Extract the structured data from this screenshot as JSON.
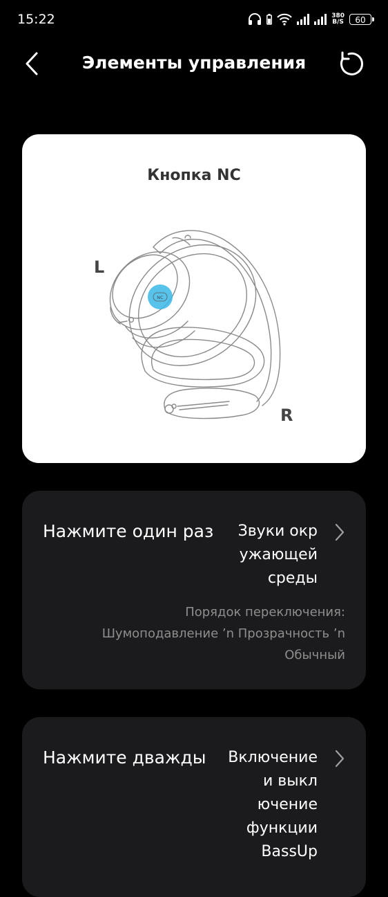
{
  "status": {
    "time": "15:22",
    "net_speed_value": "380",
    "net_speed_unit": "B/S",
    "battery": "60"
  },
  "header": {
    "title": "Элементы управления"
  },
  "image_card": {
    "title": "Кнопка NC",
    "left_label": "L",
    "right_label": "R",
    "button_label": "NC"
  },
  "actions": [
    {
      "label": "Нажмите один раз",
      "value_lines": [
        "Звуки окр",
        "ужающей",
        "среды"
      ],
      "note_lines": [
        "Порядок переключения:",
        "Шумоподавление ʼn  Прозрачность ʼn",
        "Обычный"
      ]
    },
    {
      "label": "Нажмите дважды",
      "value_lines": [
        "Включение",
        "и выкл",
        "ючение",
        "функции",
        "BassUp"
      ]
    }
  ],
  "colors": {
    "background": "#000000",
    "card": "#1b1b1d",
    "image_card": "#ffffff",
    "highlight": "#3bb8e6",
    "muted_text": "#8e8e8e"
  },
  "icons": {
    "back": "chevron-left-icon",
    "reset": "reset-icon",
    "chevron": "chevron-right-icon"
  }
}
